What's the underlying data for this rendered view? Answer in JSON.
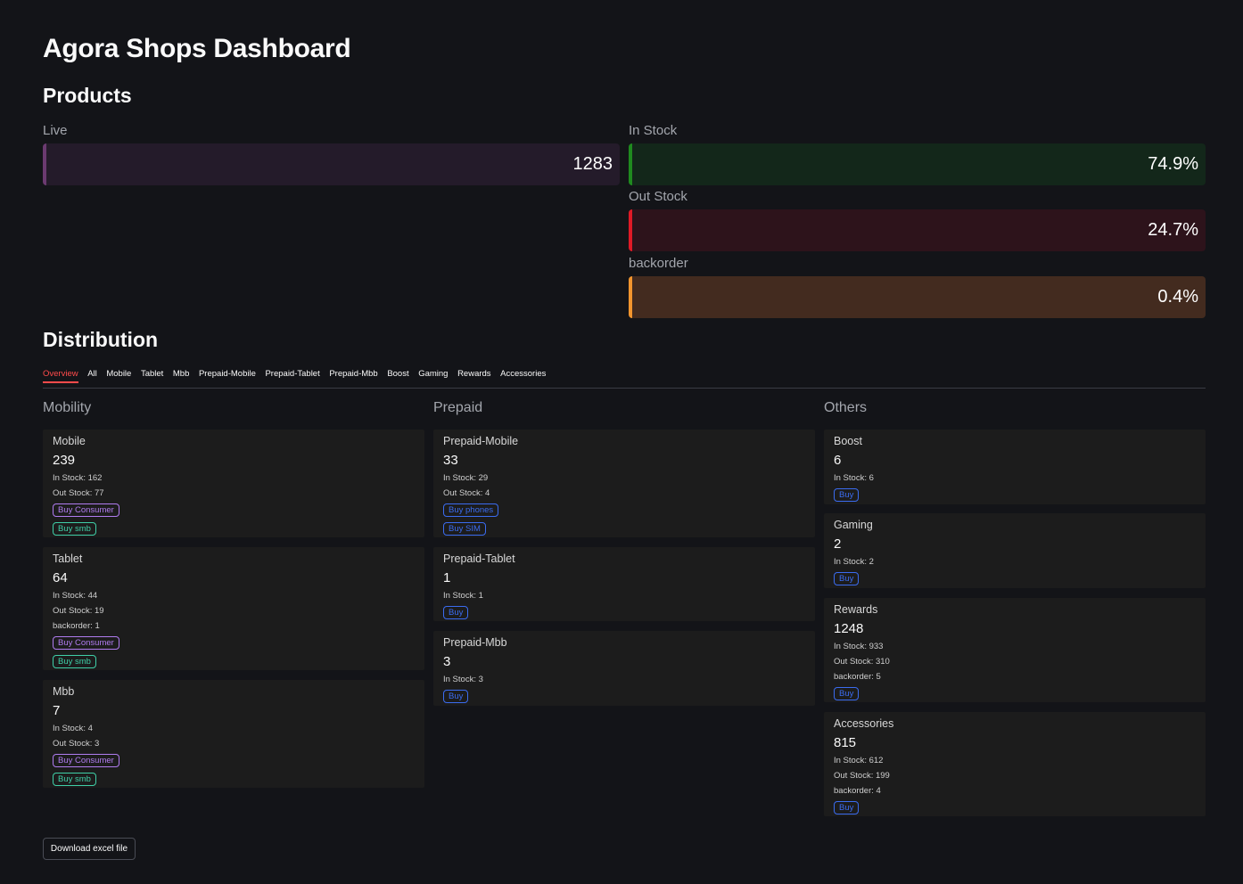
{
  "page": {
    "title": "Agora Shops Dashboard"
  },
  "products": {
    "heading": "Products",
    "live": {
      "label": "Live",
      "value": "1283",
      "accent": "#6b3a70"
    },
    "in_stock": {
      "label": "In Stock",
      "value": "74.9%",
      "accent": "#1f8a1f"
    },
    "out_stock": {
      "label": "Out Stock",
      "value": "24.7%",
      "accent": "#e01a26"
    },
    "backorder": {
      "label": "backorder",
      "value": "0.4%",
      "accent": "#f2952e"
    }
  },
  "distribution": {
    "heading": "Distribution",
    "tabs": [
      "Overview",
      "All",
      "Mobile",
      "Tablet",
      "Mbb",
      "Prepaid-Mobile",
      "Prepaid-Tablet",
      "Prepaid-Mbb",
      "Boost",
      "Gaming",
      "Rewards",
      "Accessories"
    ],
    "active_tab": "Overview",
    "columns": {
      "mobility": {
        "title": "Mobility",
        "cards": [
          {
            "name": "Mobile",
            "count": "239",
            "lines": [
              "In Stock: 162",
              "Out Stock: 77"
            ],
            "buttons": [
              "Buy Consumer",
              "Buy smb"
            ]
          },
          {
            "name": "Tablet",
            "count": "64",
            "lines": [
              "In Stock: 44",
              "Out Stock: 19",
              "backorder: 1"
            ],
            "buttons": [
              "Buy Consumer",
              "Buy smb"
            ]
          },
          {
            "name": "Mbb",
            "count": "7",
            "lines": [
              "In Stock: 4",
              "Out Stock: 3"
            ],
            "buttons": [
              "Buy Consumer",
              "Buy smb"
            ]
          }
        ]
      },
      "prepaid": {
        "title": "Prepaid",
        "cards": [
          {
            "name": "Prepaid-Mobile",
            "count": "33",
            "lines": [
              "In Stock: 29",
              "Out Stock: 4"
            ],
            "buttons": [
              "Buy phones",
              "Buy SIM"
            ]
          },
          {
            "name": "Prepaid-Tablet",
            "count": "1",
            "lines": [
              "In Stock: 1"
            ],
            "buttons": [
              "Buy"
            ]
          },
          {
            "name": "Prepaid-Mbb",
            "count": "3",
            "lines": [
              "In Stock: 3"
            ],
            "buttons": [
              "Buy"
            ]
          }
        ]
      },
      "others": {
        "title": "Others",
        "cards": [
          {
            "name": "Boost",
            "count": "6",
            "lines": [
              "In Stock: 6"
            ],
            "buttons": [
              "Buy"
            ]
          },
          {
            "name": "Gaming",
            "count": "2",
            "lines": [
              "In Stock: 2"
            ],
            "buttons": [
              "Buy"
            ]
          },
          {
            "name": "Rewards",
            "count": "1248",
            "lines": [
              "In Stock: 933",
              "Out Stock: 310",
              "backorder: 5"
            ],
            "buttons": [
              "Buy"
            ]
          },
          {
            "name": "Accessories",
            "count": "815",
            "lines": [
              "In Stock: 612",
              "Out Stock: 199",
              "backorder: 4"
            ],
            "buttons": [
              "Buy"
            ]
          }
        ]
      }
    }
  },
  "button_colors": {
    "Buy Consumer": "#b07cf0",
    "Buy smb": "#3fd0a8",
    "Buy phones": "#3b6cf0",
    "Buy SIM": "#3b6cf0",
    "Buy": "#3b6cf0"
  },
  "download": {
    "label": "Download excel file"
  }
}
